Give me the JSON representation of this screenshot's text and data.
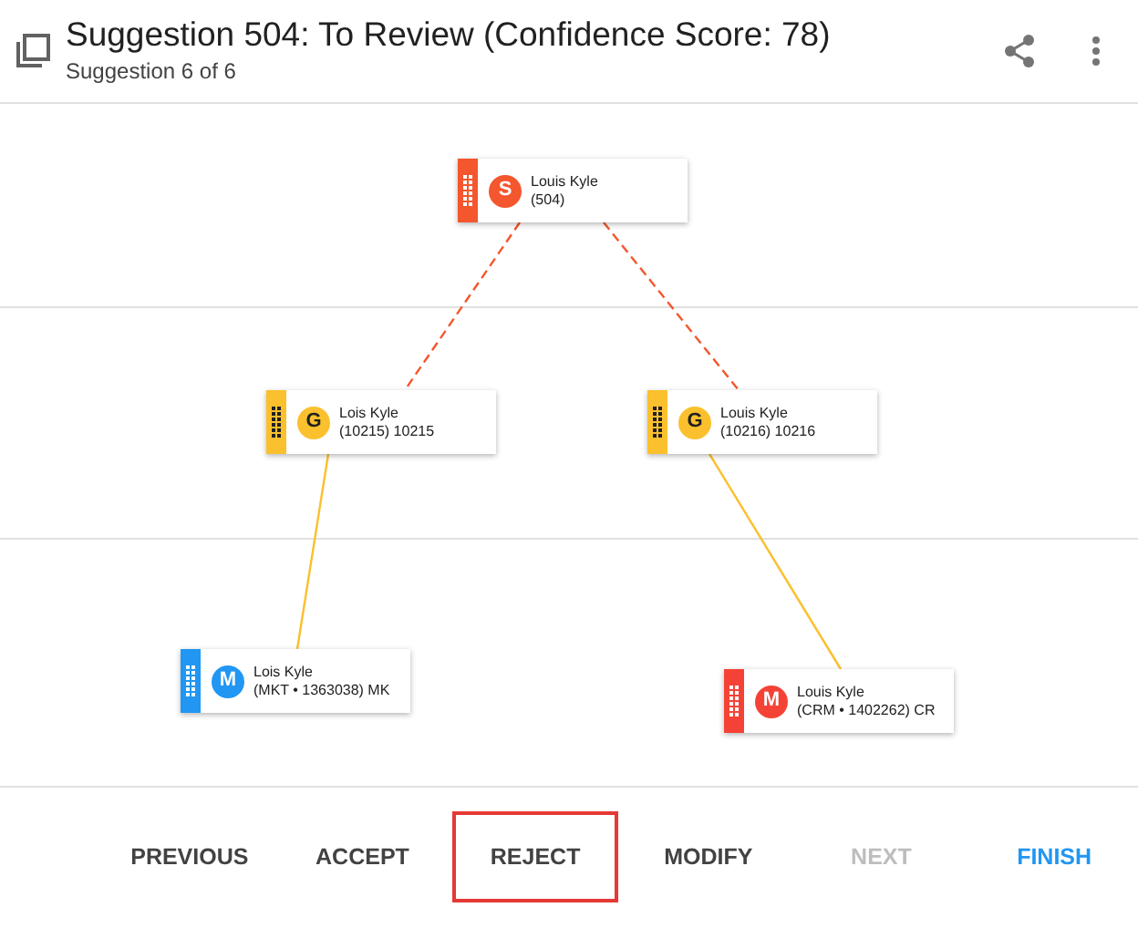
{
  "header": {
    "title": "Suggestion 504: To Review (Confidence Score: 78)",
    "subtitle": "Suggestion 6 of 6"
  },
  "tree": {
    "name": "Louis Kyle",
    "detail": "(504)",
    "letter": "S",
    "color": "#f4562d",
    "children": [
      {
        "name": "Lois Kyle",
        "detail": "(10215) 10215",
        "letter": "G",
        "color": "#fbc02d",
        "kind": "dashed",
        "children": [
          {
            "name": "Lois Kyle",
            "detail": "(MKT • 1363038) MK",
            "letter": "M",
            "color": "#2196f3",
            "kind": "solid"
          }
        ]
      },
      {
        "name": "Louis Kyle",
        "detail": "(10216) 10216",
        "letter": "G",
        "color": "#fbc02d",
        "kind": "dashed",
        "children": [
          {
            "name": "Louis Kyle",
            "detail": "(CRM • 1402262) CR",
            "letter": "M",
            "color": "#f44336",
            "kind": "solid"
          }
        ]
      }
    ]
  },
  "buttons": [
    {
      "label": "PREVIOUS",
      "selected": false,
      "disabled": false,
      "kind": "plain"
    },
    {
      "label": "ACCEPT",
      "selected": false,
      "disabled": false,
      "kind": "plain"
    },
    {
      "label": "REJECT",
      "selected": true,
      "disabled": false,
      "kind": "plain"
    },
    {
      "label": "MODIFY",
      "selected": false,
      "disabled": false,
      "kind": "plain"
    },
    {
      "label": "NEXT",
      "selected": false,
      "disabled": true,
      "kind": "plain"
    },
    {
      "label": "FINISH",
      "selected": false,
      "disabled": false,
      "kind": "primary"
    }
  ]
}
